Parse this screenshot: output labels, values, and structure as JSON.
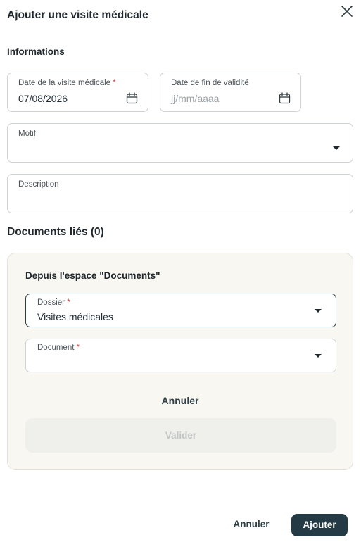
{
  "dialog": {
    "title": "Ajouter une visite médicale",
    "close_icon": "close-icon"
  },
  "informations": {
    "title": "Informations",
    "visit_date": {
      "label": "Date de la visite médicale",
      "required_mark": "*",
      "value": "07/08/2026",
      "icon": "calendar-icon"
    },
    "end_date": {
      "label": "Date de fin de validité",
      "placeholder": "jj/mm/aaaa",
      "icon": "calendar-icon"
    },
    "motif": {
      "label": "Motif",
      "value": ""
    },
    "description": {
      "label": "Description",
      "value": ""
    }
  },
  "documents": {
    "title": "Documents liés (0)",
    "panel": {
      "title": "Depuis l'espace \"Documents\"",
      "dossier": {
        "label": "Dossier",
        "required_mark": "*",
        "value": "Visites médicales"
      },
      "document": {
        "label": "Document",
        "required_mark": "*",
        "value": ""
      },
      "cancel_label": "Annuler",
      "validate_label": "Valider"
    }
  },
  "footer": {
    "cancel_label": "Annuler",
    "add_label": "Ajouter"
  },
  "colors": {
    "primary": "#243b45",
    "required": "#d93b3b",
    "panel_bg": "#f8f7f2"
  }
}
